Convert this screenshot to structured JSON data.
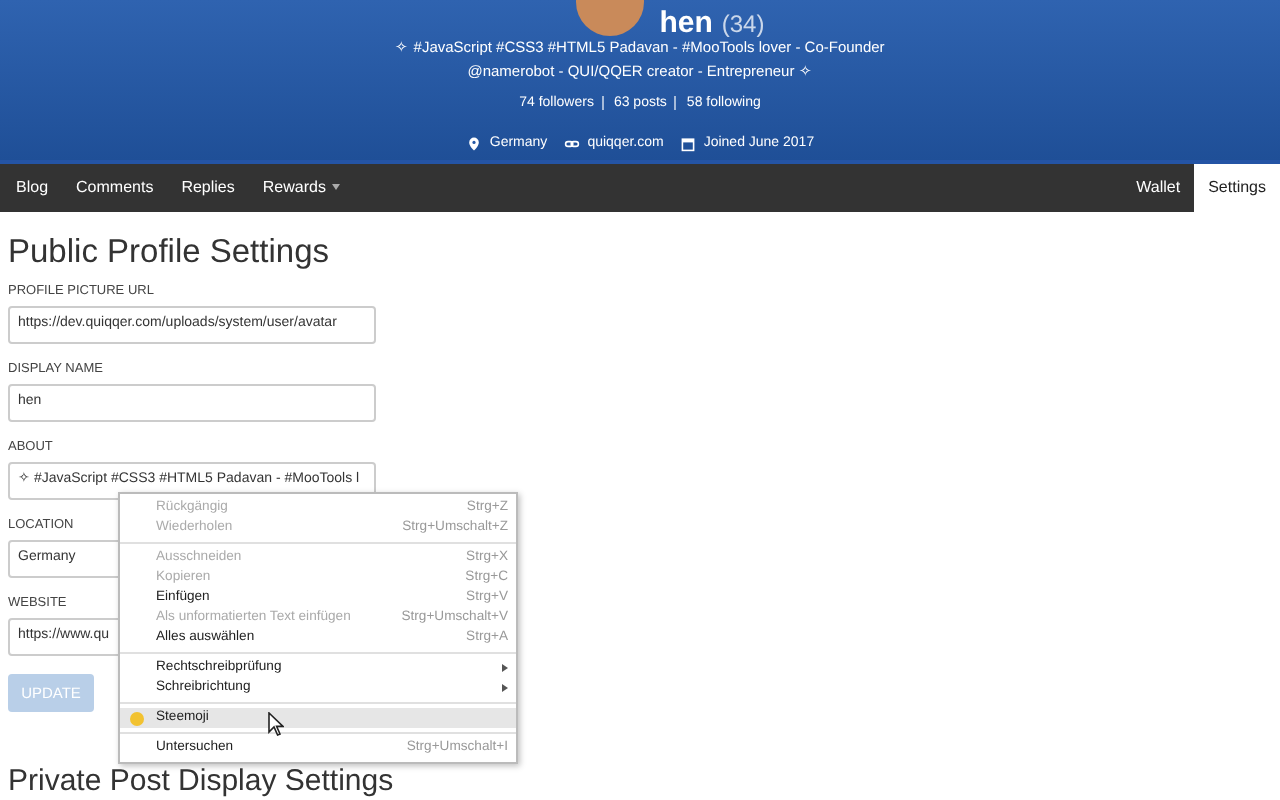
{
  "profile": {
    "name": "hen",
    "reputation": "(34)",
    "bio": "✧ #JavaScript #CSS3 #HTML5 Padavan - #MooTools lover - Co-Founder @namerobot - QUI/QQER creator - Entrepreneur ✧",
    "stats": [
      "74 followers",
      "63 posts",
      "58 following"
    ],
    "meta": [
      {
        "kind": "location",
        "text": "Germany"
      },
      {
        "kind": "link",
        "text": "quiqqer.com"
      },
      {
        "kind": "date",
        "text": "Joined June 2017"
      }
    ]
  },
  "nav": {
    "left": [
      {
        "label": "Blog",
        "selected": false,
        "dropdown": false
      },
      {
        "label": "Comments",
        "selected": false,
        "dropdown": false
      },
      {
        "label": "Replies",
        "selected": false,
        "dropdown": false
      },
      {
        "label": "Rewards",
        "selected": false,
        "dropdown": true
      }
    ],
    "right": [
      {
        "label": "Wallet",
        "selected": false
      },
      {
        "label": "Settings",
        "selected": true
      }
    ]
  },
  "form": {
    "title": "Public Profile Settings",
    "fields": [
      {
        "label": "PROFILE PICTURE URL",
        "value": "https://dev.quiqqer.com/uploads/system/user/avatar"
      },
      {
        "label": "DISPLAY NAME",
        "value": "hen"
      },
      {
        "label": "ABOUT",
        "value": "✧ #JavaScript #CSS3 #HTML5 Padavan - #MooTools l"
      },
      {
        "label": "LOCATION",
        "value": "Germany"
      },
      {
        "label": "WEBSITE",
        "value": "https://www.qu"
      }
    ],
    "button": {
      "label": "UPDATE",
      "disabled": true
    },
    "next_title": "Private Post Display Settings"
  },
  "context_menu": [
    {
      "kind": "item",
      "label": "Rückgängig",
      "shortcut": "Strg+Z",
      "disabled": true,
      "selected": false
    },
    {
      "kind": "item",
      "label": "Wiederholen",
      "shortcut": "Strg+Umschalt+Z",
      "disabled": true,
      "selected": false
    },
    {
      "kind": "separator"
    },
    {
      "kind": "item",
      "label": "Ausschneiden",
      "shortcut": "Strg+X",
      "disabled": true,
      "selected": false
    },
    {
      "kind": "item",
      "label": "Kopieren",
      "shortcut": "Strg+C",
      "disabled": true,
      "selected": false
    },
    {
      "kind": "item",
      "label": "Einfügen",
      "shortcut": "Strg+V",
      "disabled": false,
      "selected": false
    },
    {
      "kind": "item",
      "label": "Als unformatierten Text einfügen",
      "shortcut": "Strg+Umschalt+V",
      "disabled": true,
      "selected": false
    },
    {
      "kind": "item",
      "label": "Alles auswählen",
      "shortcut": "Strg+A",
      "disabled": false,
      "selected": false
    },
    {
      "kind": "separator"
    },
    {
      "kind": "submenu",
      "label": "Rechtschreibprüfung",
      "disabled": false,
      "selected": false
    },
    {
      "kind": "submenu",
      "label": "Schreibrichtung",
      "disabled": false,
      "selected": false
    },
    {
      "kind": "separator"
    },
    {
      "kind": "extension",
      "label": "Steemoji",
      "disabled": false,
      "selected": true
    },
    {
      "kind": "separator"
    },
    {
      "kind": "item",
      "label": "Untersuchen",
      "shortcut": "Strg+Umschalt+I",
      "disabled": false,
      "selected": false
    }
  ]
}
